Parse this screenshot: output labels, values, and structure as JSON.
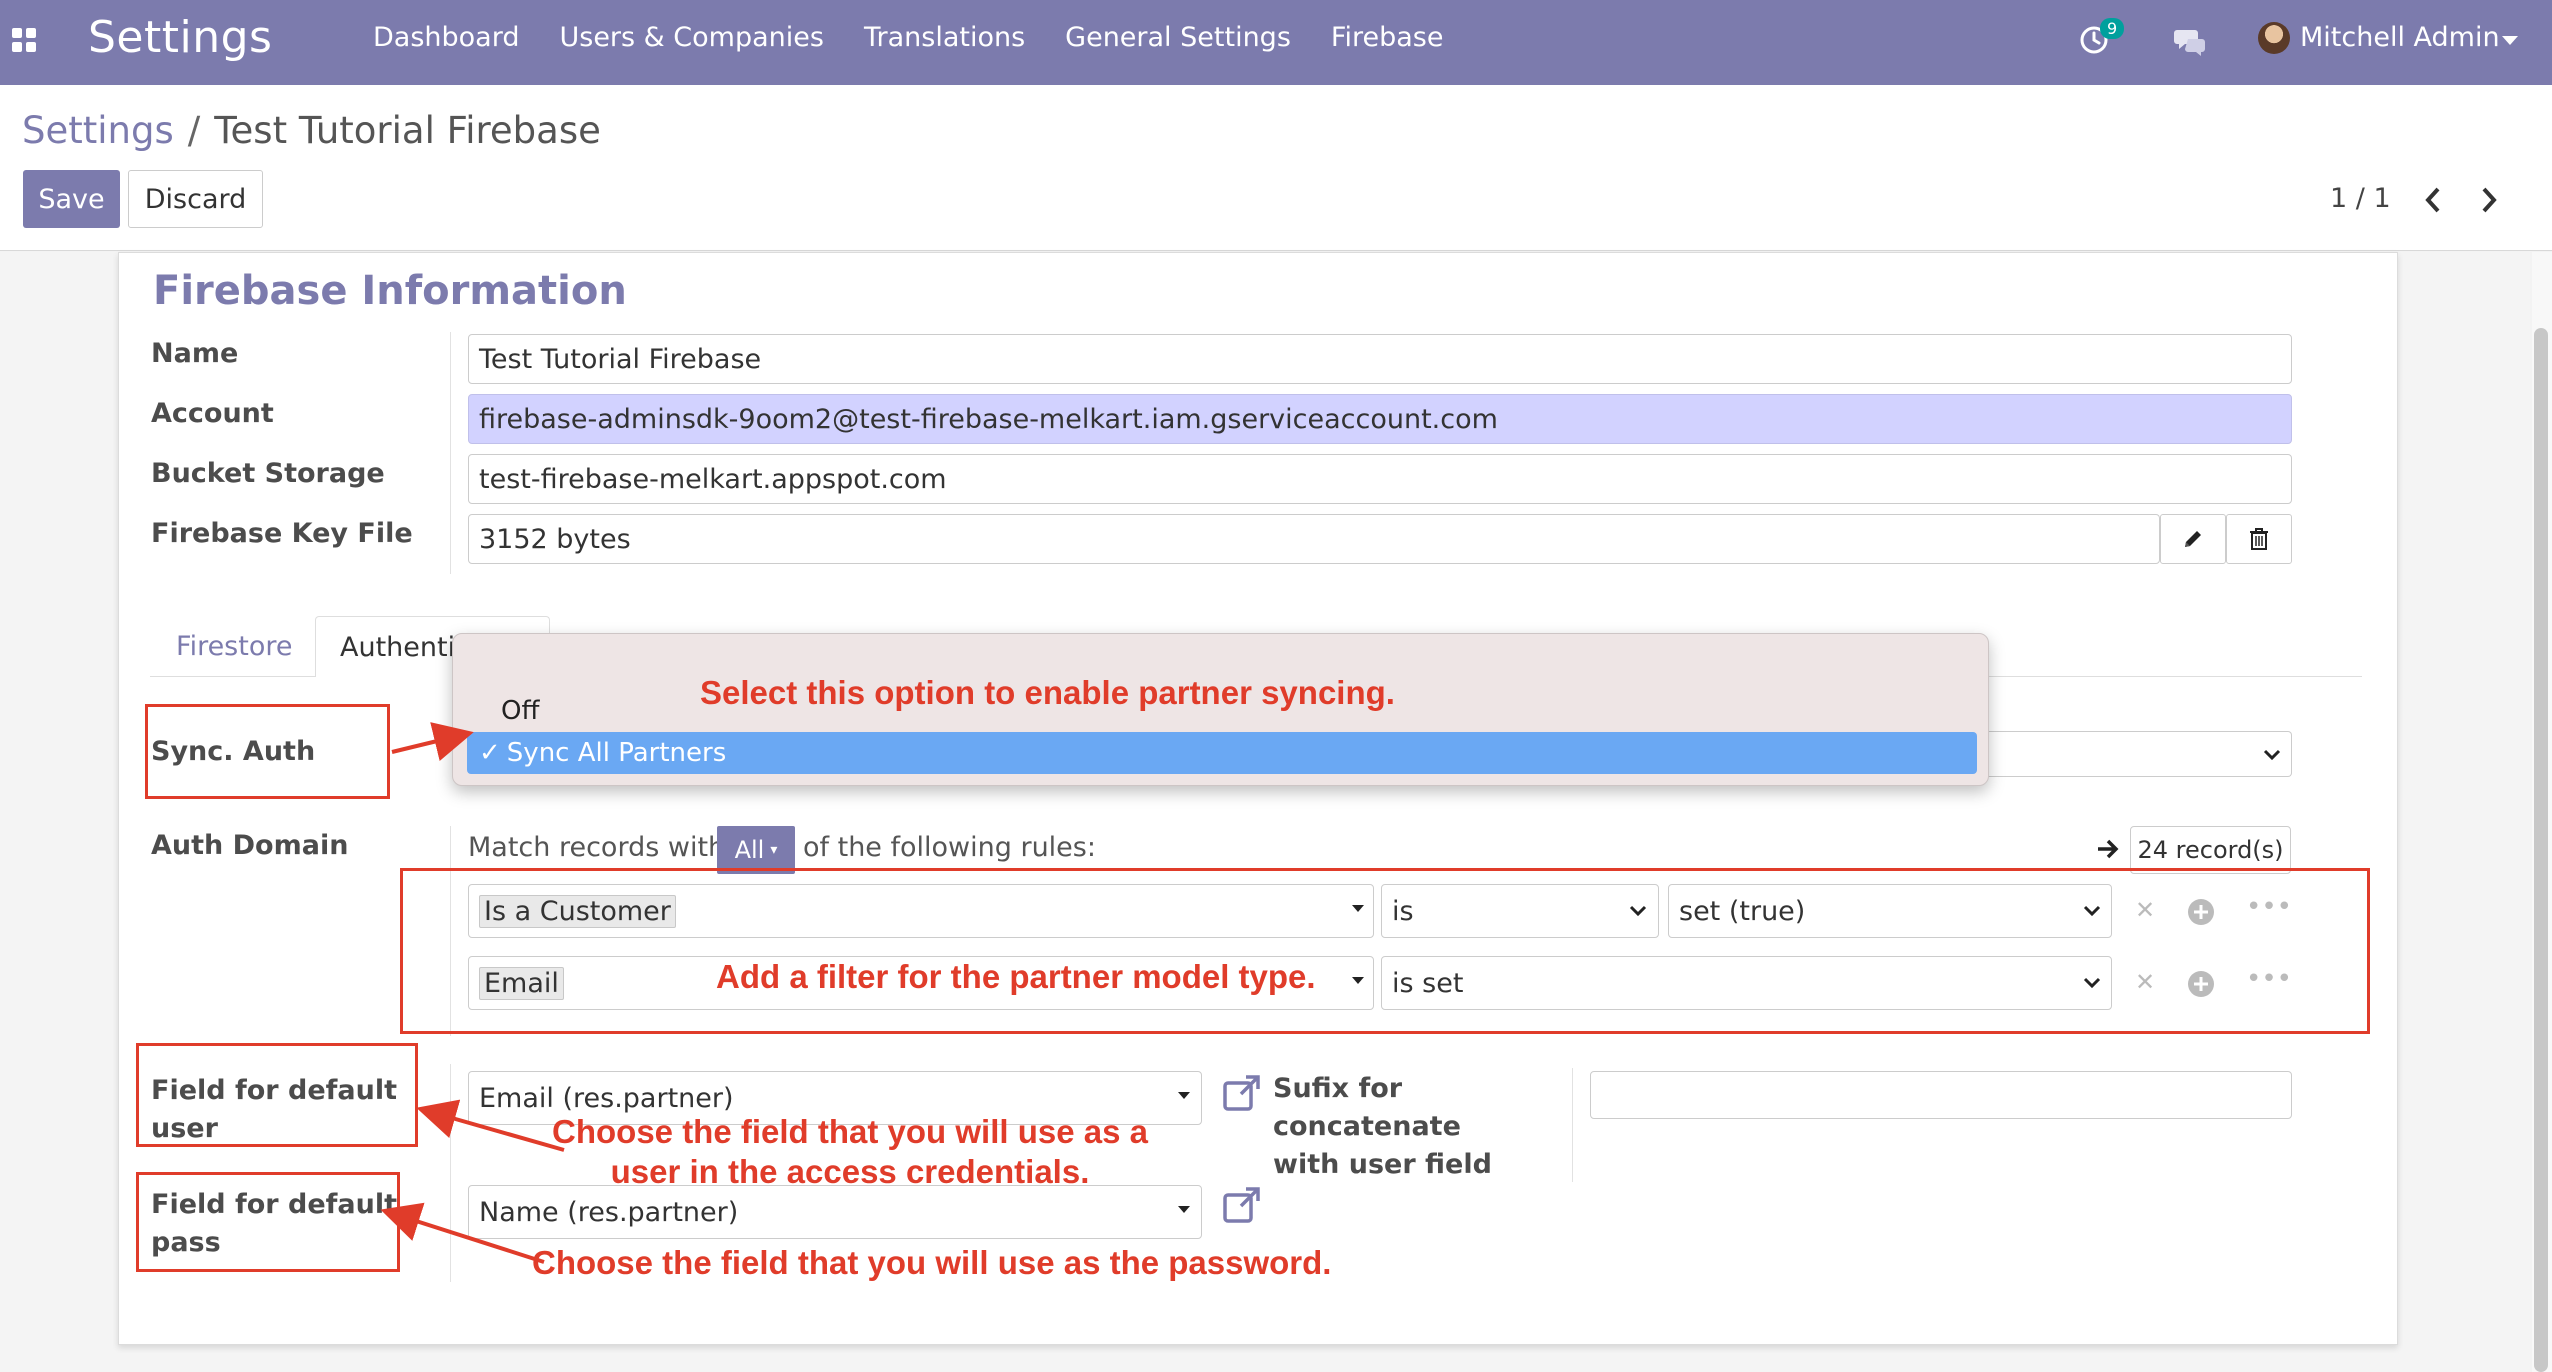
{
  "navbar": {
    "app_name": "Settings",
    "menu": [
      "Dashboard",
      "Users & Companies",
      "Translations",
      "General Settings",
      "Firebase"
    ],
    "activity_count": "9",
    "user_name": "Mitchell Admin",
    "icons": [
      "apps-icon",
      "clock-icon",
      "chat-icon",
      "avatar",
      "chevron-down-icon"
    ],
    "colors": {
      "brand": "#7c7bad",
      "accent_badge": "#00a09d"
    }
  },
  "breadcrumb": {
    "parent": "Settings",
    "separator": "/",
    "current": "Test Tutorial Firebase"
  },
  "actions": {
    "save_label": "Save",
    "discard_label": "Discard"
  },
  "pager": {
    "value": "1 / 1"
  },
  "form": {
    "section_title": "Firebase Information",
    "name": {
      "label": "Name",
      "value": "Test Tutorial Firebase"
    },
    "account": {
      "label": "Account",
      "value": "firebase-adminsdk-9oom2@test-firebase-melkart.iam.gserviceaccount.com"
    },
    "bucket": {
      "label": "Bucket Storage",
      "value": "test-firebase-melkart.appspot.com"
    },
    "key_file": {
      "label": "Firebase Key File",
      "value": "3152 bytes"
    }
  },
  "tabs": [
    "Firestore",
    "Authentication"
  ],
  "auth": {
    "sync_label": "Sync. Auth",
    "sync_options": [
      "Off",
      "Sync All Partners"
    ],
    "sync_selected": "Sync All Partners",
    "domain_label": "Auth Domain",
    "match_prefix": "Match records with",
    "match_mode": "All",
    "match_suffix": "of the following rules:",
    "records": "24 record(s)",
    "rules": [
      {
        "field": "Is a Customer",
        "operator": "is",
        "value": "set (true)"
      },
      {
        "field": "Email",
        "operator": "is set",
        "value": ""
      }
    ],
    "default_user_label": "Field for default user",
    "default_user_value": "Email (res.partner)",
    "sufix_label": "Sufix for concatenate with user field",
    "sufix_value": "",
    "default_pass_label": "Field for default pass",
    "default_pass_value": "Name (res.partner)"
  },
  "annotations": {
    "sync": "Select this option to enable partner syncing.",
    "filter": "Add a filter for the partner model type.",
    "user_line1": "Choose the field that you will use as a",
    "user_line2": "user in the access credentials.",
    "pass": "Choose the field that you will use as the password.",
    "color": "#e03c2a"
  }
}
